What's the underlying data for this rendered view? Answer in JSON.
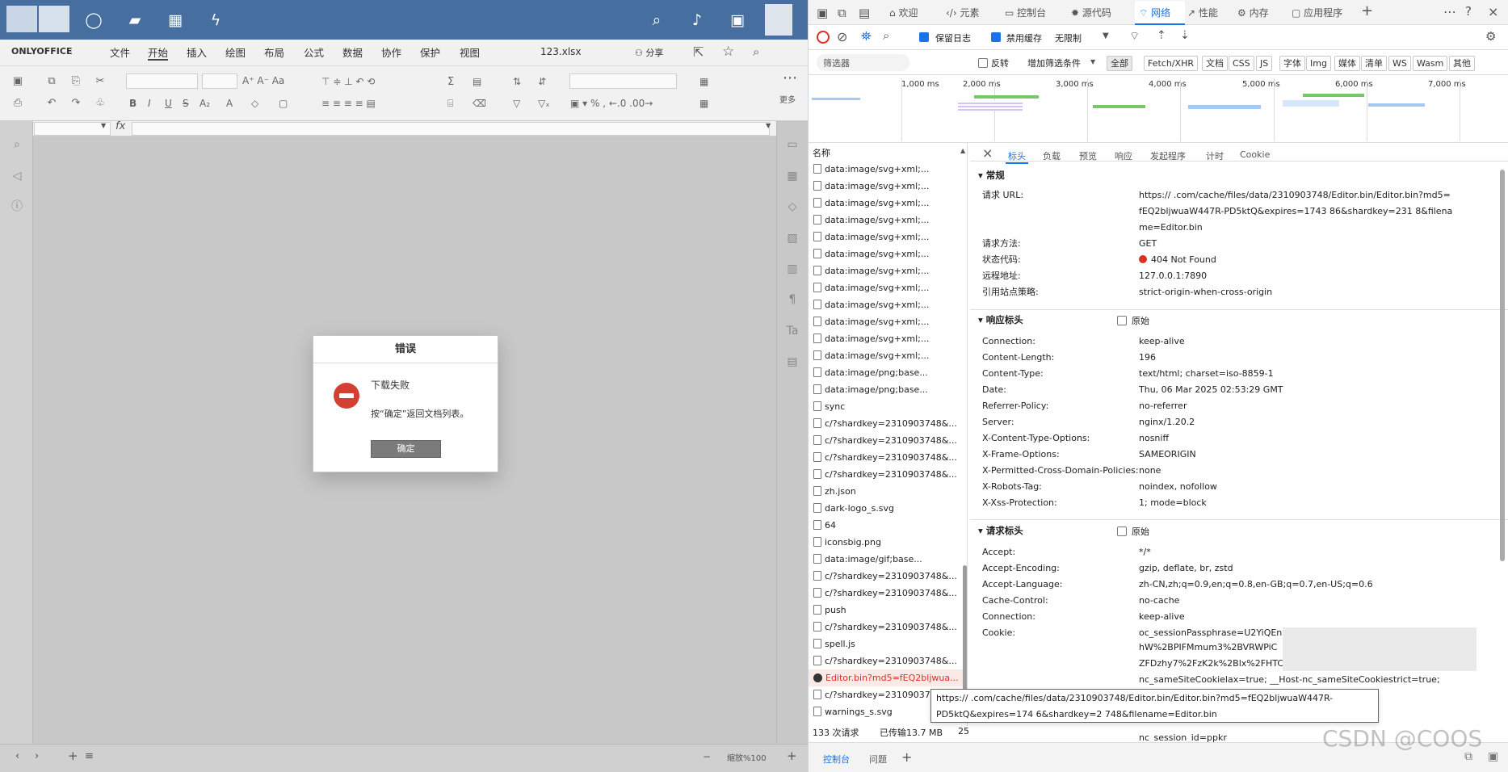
{
  "editor": {
    "brand": "ONLYOFFICE",
    "file_name": "123.xlsx",
    "menu": [
      "文件",
      "开始",
      "插入",
      "绘图",
      "布局",
      "公式",
      "数据",
      "协作",
      "保护",
      "视图"
    ],
    "share_label": "分享",
    "more_label": "更多",
    "fx_label": "fx",
    "zoom_label": "缩放%100",
    "icons": [
      "menu-logo",
      "search-icon",
      "notification-icon",
      "profile-icon",
      "file-icon",
      "home-icon",
      "image-icon",
      "flash-icon"
    ]
  },
  "dialog": {
    "title": "错误",
    "message": "下载失败",
    "sub_message": "按“确定”返回文档列表。",
    "ok_label": "确定"
  },
  "devtools": {
    "tabs": [
      "欢迎",
      "元素",
      "控制台",
      "源代码",
      "网络",
      "性能",
      "内存",
      "应用程序"
    ],
    "active_tab": "网络",
    "options": {
      "preserve_log": "保留日志",
      "disable_cache": "禁用缓存",
      "throttle": "无限制"
    },
    "filter": {
      "placeholder": "筛选器",
      "invert": "反转",
      "more_filters": "增加筛选条件",
      "types": [
        "全部",
        "Fetch/XHR",
        "文档",
        "CSS",
        "JS",
        "字体",
        "Img",
        "媒体",
        "清单",
        "WS",
        "Wasm",
        "其他"
      ]
    },
    "timeline": [
      "1,000 ms",
      "2,000 ms",
      "3,000 ms",
      "4,000 ms",
      "5,000 ms",
      "6,000 ms",
      "7,000 ms"
    ],
    "request_list_header": "名称",
    "requests": [
      "data:image/svg+xml;...",
      "data:image/svg+xml;...",
      "data:image/svg+xml;...",
      "data:image/svg+xml;...",
      "data:image/svg+xml;...",
      "data:image/svg+xml;...",
      "data:image/svg+xml;...",
      "data:image/svg+xml;...",
      "data:image/svg+xml;...",
      "data:image/svg+xml;...",
      "data:image/svg+xml;...",
      "data:image/svg+xml;...",
      "data:image/png;base...",
      "data:image/png;base...",
      "sync",
      "c/?shardkey=2310903748&...",
      "c/?shardkey=2310903748&...",
      "c/?shardkey=2310903748&...",
      "c/?shardkey=2310903748&...",
      "zh.json",
      "dark-logo_s.svg",
      "64",
      "iconsbig.png",
      "data:image/gif;base...",
      "c/?shardkey=2310903748&...",
      "c/?shardkey=2310903748&...",
      "push",
      "c/?shardkey=2310903748&...",
      "spell.js",
      "c/?shardkey=2310903748&...",
      "Editor.bin?md5=fEQ2bljwua...",
      "c/?shardkey=2310903748&...",
      "warnings_s.svg"
    ],
    "summary": {
      "requests": "133 次请求",
      "transferred": "已传输13.7 MB",
      "extra": "25"
    },
    "detail_tabs": [
      "标头",
      "负载",
      "预览",
      "响应",
      "发起程序",
      "计时",
      "Cookie"
    ],
    "general_title": "常规",
    "general": [
      {
        "key": "请求 URL:",
        "value": "https://                    .com/cache/files/data/2310903748/Editor.bin/Editor.bin?md5="
      },
      {
        "key": "",
        "value": "fEQ2bljwuaW447R-PD5ktQ&expires=1743      86&shardkey=231          8&filena"
      },
      {
        "key": "",
        "value": "me=Editor.bin"
      },
      {
        "key": "请求方法:",
        "value": "GET"
      },
      {
        "key": "状态代码:",
        "value": "404 Not Found"
      },
      {
        "key": "远程地址:",
        "value": "127.0.0.1:7890"
      },
      {
        "key": "引用站点策略:",
        "value": "strict-origin-when-cross-origin"
      }
    ],
    "response_title": "响应标头",
    "raw_label": "原始",
    "response_headers": [
      {
        "key": "Connection:",
        "value": "keep-alive"
      },
      {
        "key": "Content-Length:",
        "value": "196"
      },
      {
        "key": "Content-Type:",
        "value": "text/html; charset=iso-8859-1"
      },
      {
        "key": "Date:",
        "value": "Thu, 06 Mar 2025 02:53:29 GMT"
      },
      {
        "key": "Referrer-Policy:",
        "value": "no-referrer"
      },
      {
        "key": "Server:",
        "value": "nginx/1.20.2"
      },
      {
        "key": "X-Content-Type-Options:",
        "value": "nosniff"
      },
      {
        "key": "X-Frame-Options:",
        "value": "SAMEORIGIN"
      },
      {
        "key": "X-Permitted-Cross-Domain-Policies:",
        "value": "none"
      },
      {
        "key": "X-Robots-Tag:",
        "value": "noindex, nofollow"
      },
      {
        "key": "X-Xss-Protection:",
        "value": "1; mode=block"
      }
    ],
    "request_title": "请求标头",
    "request_headers": [
      {
        "key": "Accept:",
        "value": "*/*"
      },
      {
        "key": "Accept-Encoding:",
        "value": "gzip, deflate, br, zstd"
      },
      {
        "key": "Accept-Language:",
        "value": "zh-CN,zh;q=0.9,en;q=0.8,en-GB;q=0.7,en-US;q=0.6"
      },
      {
        "key": "Cache-Control:",
        "value": "no-cache"
      },
      {
        "key": "Connection:",
        "value": "keep-alive"
      },
      {
        "key": "Cookie:",
        "value": "oc_sessionPassphrase=U2YiQEn"
      }
    ],
    "cookie_lines": [
      "hW%2BPIFMmum3%2BVRWPiC",
      "ZFDzhy7%2FzK2k%2Blx%2FHTCZiTihdEse07077; __Host-",
      "nc_sameSiteCookielax=true; __Host-nc_sameSiteCookiestrict=true;",
      "nc_session_id=ppkr"
    ],
    "tooltip_lines": [
      "https://               .com/cache/files/data/2310903748/Editor.bin/Editor.bin?md5=fEQ2bljwuaW447R-",
      "PD5ktQ&expires=174         6&shardkey=2            748&filename=Editor.bin"
    ],
    "drawer_tabs": [
      "控制台",
      "问题"
    ],
    "watermark": "CSDN @COOS"
  },
  "colors": {
    "editor_header": "#466fa0",
    "dialog_error": "#d33f32",
    "status_error": "#d93025",
    "devtools_accent": "#1a73e8"
  }
}
